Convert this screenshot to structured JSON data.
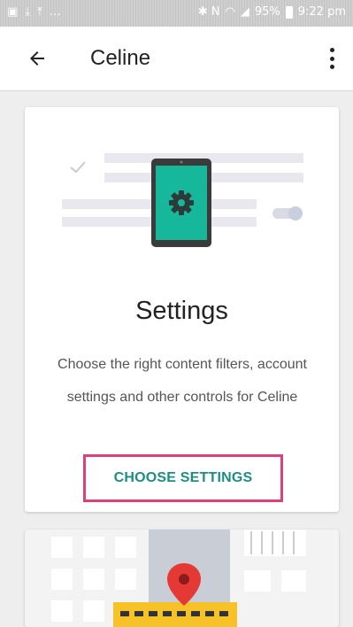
{
  "status_bar": {
    "signal_icons": "✱ N",
    "battery": "95%",
    "time": "9:22 pm"
  },
  "app_bar": {
    "title": "Celine"
  },
  "settings_card": {
    "title": "Settings",
    "description": "Choose the right content filters, account settings and other controls for Celine",
    "button_label": "CHOOSE SETTINGS"
  },
  "colors": {
    "accent_teal": "#1a8f85",
    "phone_screen": "#17b79b",
    "highlight_border": "#e0407a",
    "map_pin": "#e53935"
  },
  "icons": [
    "back-arrow-icon",
    "more-vert-icon",
    "gear-icon",
    "check-icon",
    "toggle-icon",
    "map-pin-icon"
  ]
}
